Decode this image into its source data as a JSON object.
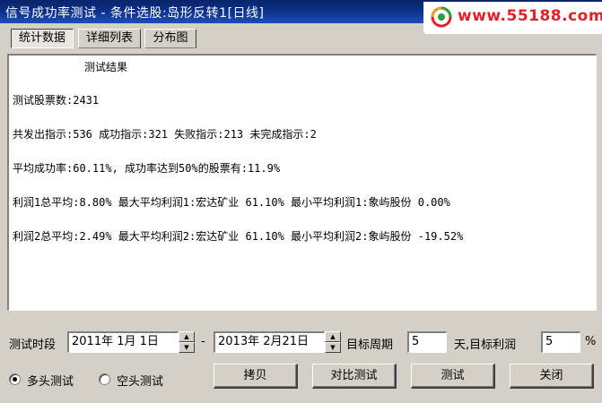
{
  "window": {
    "title": "信号成功率测试 - 条件选股:岛形反转1[日线]"
  },
  "logo": {
    "text": "www.55188.com"
  },
  "tabs": [
    {
      "label": "统计数据",
      "active": true
    },
    {
      "label": "详细列表",
      "active": false
    },
    {
      "label": "分布图",
      "active": false
    }
  ],
  "results": {
    "heading": "测试结果",
    "lines": [
      "测试股票数:2431",
      "共发出指示:536 成功指示:321 失败指示:213 未完成指示:2",
      "平均成功率:60.11%, 成功率达到50%的股票有:11.9%",
      "利润1总平均:8.80% 最大平均利润1:宏达矿业 61.10% 最小平均利润1:象屿股份 0.00%",
      "利润2总平均:2.49% 最大平均利润2:宏达矿业 61.10% 最小平均利润2:象屿股份 -19.52%"
    ]
  },
  "controls": {
    "period_label": "测试时段",
    "start_date": "2011年 1月 1日",
    "separator": "-",
    "end_date": "2013年 2月21日",
    "target_period_label": "目标周期",
    "target_period_value": "5",
    "days_target_profit_label": "天,目标利润",
    "target_profit_value": "5",
    "percent_sign": "%"
  },
  "radios": [
    {
      "label": "多头测试",
      "checked": true
    },
    {
      "label": "空头测试",
      "checked": false
    }
  ],
  "buttons": {
    "copy": "拷贝",
    "compare": "对比测试",
    "test": "测试",
    "close": "关闭"
  },
  "colors": {
    "titlebar": "#0a246a",
    "logo_text": "#e61e28",
    "dialog_bg": "#d4d0c8"
  }
}
